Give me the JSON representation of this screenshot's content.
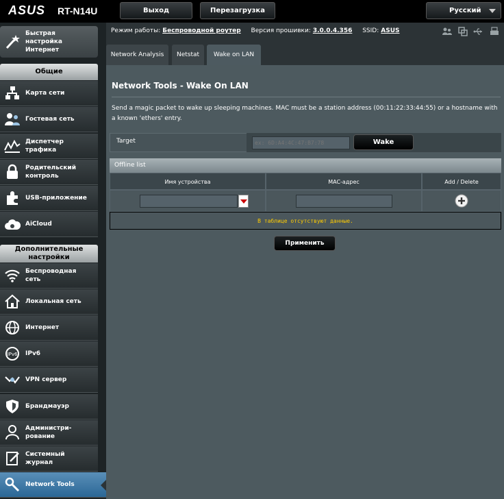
{
  "header": {
    "brand": "ASUS",
    "model": "RT-N14U",
    "logout_label": "Выход",
    "reboot_label": "Перезагрузка",
    "language": "Русский"
  },
  "status": {
    "mode_label": "Режим работы:",
    "mode_value": "Беспроводной роутер",
    "fw_label": "Версия прошивки:",
    "fw_value": "3.0.0.4.356",
    "ssid_label": "SSID:",
    "ssid_value": "ASUS"
  },
  "sidebar": {
    "quick_setup": "Быстрая настройка Интернет",
    "general_title": "Общие",
    "general_items": [
      {
        "label": "Карта сети",
        "icon": "network-map-icon"
      },
      {
        "label": "Гостевая сеть",
        "icon": "guest-network-icon"
      },
      {
        "label": "Диспетчер трафика",
        "icon": "traffic-manager-icon"
      },
      {
        "label": "Родительский контроль",
        "icon": "parental-control-icon"
      },
      {
        "label": "USB-приложение",
        "icon": "usb-app-icon"
      },
      {
        "label": "AiCloud",
        "icon": "aicloud-icon"
      }
    ],
    "advanced_title": "Дополнительные настройки",
    "advanced_items": [
      {
        "label": "Беспроводная сеть",
        "icon": "wireless-icon"
      },
      {
        "label": "Локальная сеть",
        "icon": "lan-icon"
      },
      {
        "label": "Интернет",
        "icon": "internet-icon"
      },
      {
        "label": "IPv6",
        "icon": "ipv6-icon"
      },
      {
        "label": "VPN сервер",
        "icon": "vpn-icon"
      },
      {
        "label": "Брандмауэр",
        "icon": "firewall-icon"
      },
      {
        "label": "Администри-рование",
        "icon": "administration-icon"
      },
      {
        "label": "Системный журнал",
        "icon": "system-log-icon"
      },
      {
        "label": "Network Tools",
        "icon": "network-tools-icon"
      }
    ]
  },
  "tabs": [
    {
      "label": "Network Analysis"
    },
    {
      "label": "Netstat"
    },
    {
      "label": "Wake on LAN"
    }
  ],
  "main": {
    "title": "Network Tools - Wake On LAN",
    "description": "Send a magic packet to wake up sleeping machines. MAC must be a station address (00:11:22:33:44:55) or a hostname with a known 'ethers' entry.",
    "target_label": "Target",
    "target_placeholder": "ex: 6D:A4:4C:47:B7:78",
    "wake_label": "Wake",
    "offline_list": "Offline list",
    "col_device": "Имя устройства",
    "col_mac": "MAC-адрес",
    "col_action": "Add / Delete",
    "no_data": "В таблице отсутствуют данные.",
    "apply_label": "Применить"
  },
  "colors": {
    "accent": "#2b6796",
    "warning_text": "#ffcc00"
  }
}
